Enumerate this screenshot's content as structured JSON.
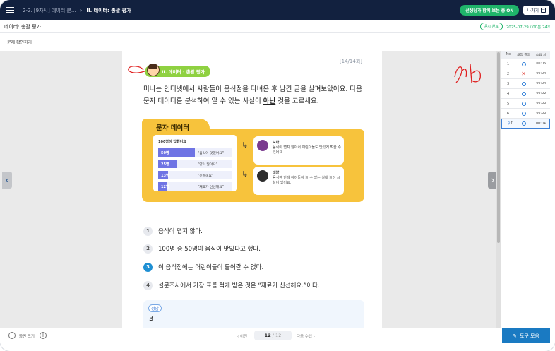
{
  "topbar": {
    "breadcrumb": "2-2. [9차시] 데이터 분...",
    "separator": "›",
    "current": "II. 데이터: 총괄 평가",
    "live_button": "선생님과 함께 보는 중 ON",
    "exit_button": "나가기"
  },
  "titlebar": {
    "title": "데이터: 총괄 평가",
    "submit_badge": "응시 완료",
    "submit_time": "2025-07-29 / 00분 24초"
  },
  "subheader": {
    "label": "문제 확인하기"
  },
  "question": {
    "page_count": "[14/14회]",
    "unit": "II. 데이터 : 총괄 평가",
    "text_1": "미나는 인터넷에서 사람들이 음식점을 다녀온 후 남긴 글을 살펴보았어요. 다음 문자 데이터를 분석하여 알 수 있는 사실이 ",
    "text_emph": "아닌",
    "text_2": " 것을 고르세요."
  },
  "card": {
    "title": "문자 데이터",
    "survey_title": "100명이 답했어요",
    "rows": [
      {
        "count": "50명",
        "comment": "\"음식이 맛있어요\"",
        "fraction": 0.5
      },
      {
        "count": "25명",
        "comment": "\"양이 많아요\"",
        "fraction": 0.25
      },
      {
        "count": "13명",
        "comment": "\"친절해요\"",
        "fraction": 0.13
      },
      {
        "count": "12명",
        "comment": "\"재료가 신선해요\"",
        "fraction": 0.12
      }
    ],
    "person1_name": "보라",
    "person1_text": "음식이 맵지 않아서 어린이들도 맛있게 먹을 수 있어요.",
    "person2_name": "태양",
    "person2_text": "음식점 안에 아이들이 놀 수 있는 실내 놀이 시설이 있어요."
  },
  "options": [
    {
      "num": "1",
      "text": "음식이 맵지 않다."
    },
    {
      "num": "2",
      "text": "100명 중 50명이 음식이 맛있다고 했다."
    },
    {
      "num": "3",
      "text": "이 음식점에는 어린이들이 들어갈 수 없다."
    },
    {
      "num": "4",
      "text": "설문조사에서 가장 표를 적게 받은 것은 “재료가 신선해요.”이다."
    }
  ],
  "selected_option": "3",
  "answer": {
    "label": "정답",
    "value": "3"
  },
  "results": {
    "headers": [
      "No",
      "채점 결과",
      "소요 시"
    ],
    "rows": [
      {
        "no": "1",
        "result": "correct",
        "time": "00:06"
      },
      {
        "no": "2",
        "result": "wrong",
        "time": "00:04"
      },
      {
        "no": "3",
        "result": "correct",
        "time": "00:04"
      },
      {
        "no": "4",
        "result": "correct",
        "time": "00:02"
      },
      {
        "no": "5",
        "result": "correct",
        "time": "00:03"
      },
      {
        "no": "6",
        "result": "correct",
        "time": "00:03"
      },
      {
        "no": "7",
        "result": "correct",
        "time": "00:04"
      }
    ],
    "active_row": "7"
  },
  "bottombar": {
    "zoom_label": "화면 크기",
    "prev": "‹ 이전",
    "page_current": "12",
    "page_total": "/ 12",
    "next": "다음 수업 ›",
    "tools": "도구 모음"
  },
  "colors": {
    "topbar": "#12213f",
    "accent_green": "#1fb46a",
    "card_yellow": "#f7c33c",
    "survey_bar": "#6f74e4",
    "selected_blue": "#1e8fd3",
    "tools_blue": "#1a7ac2"
  }
}
